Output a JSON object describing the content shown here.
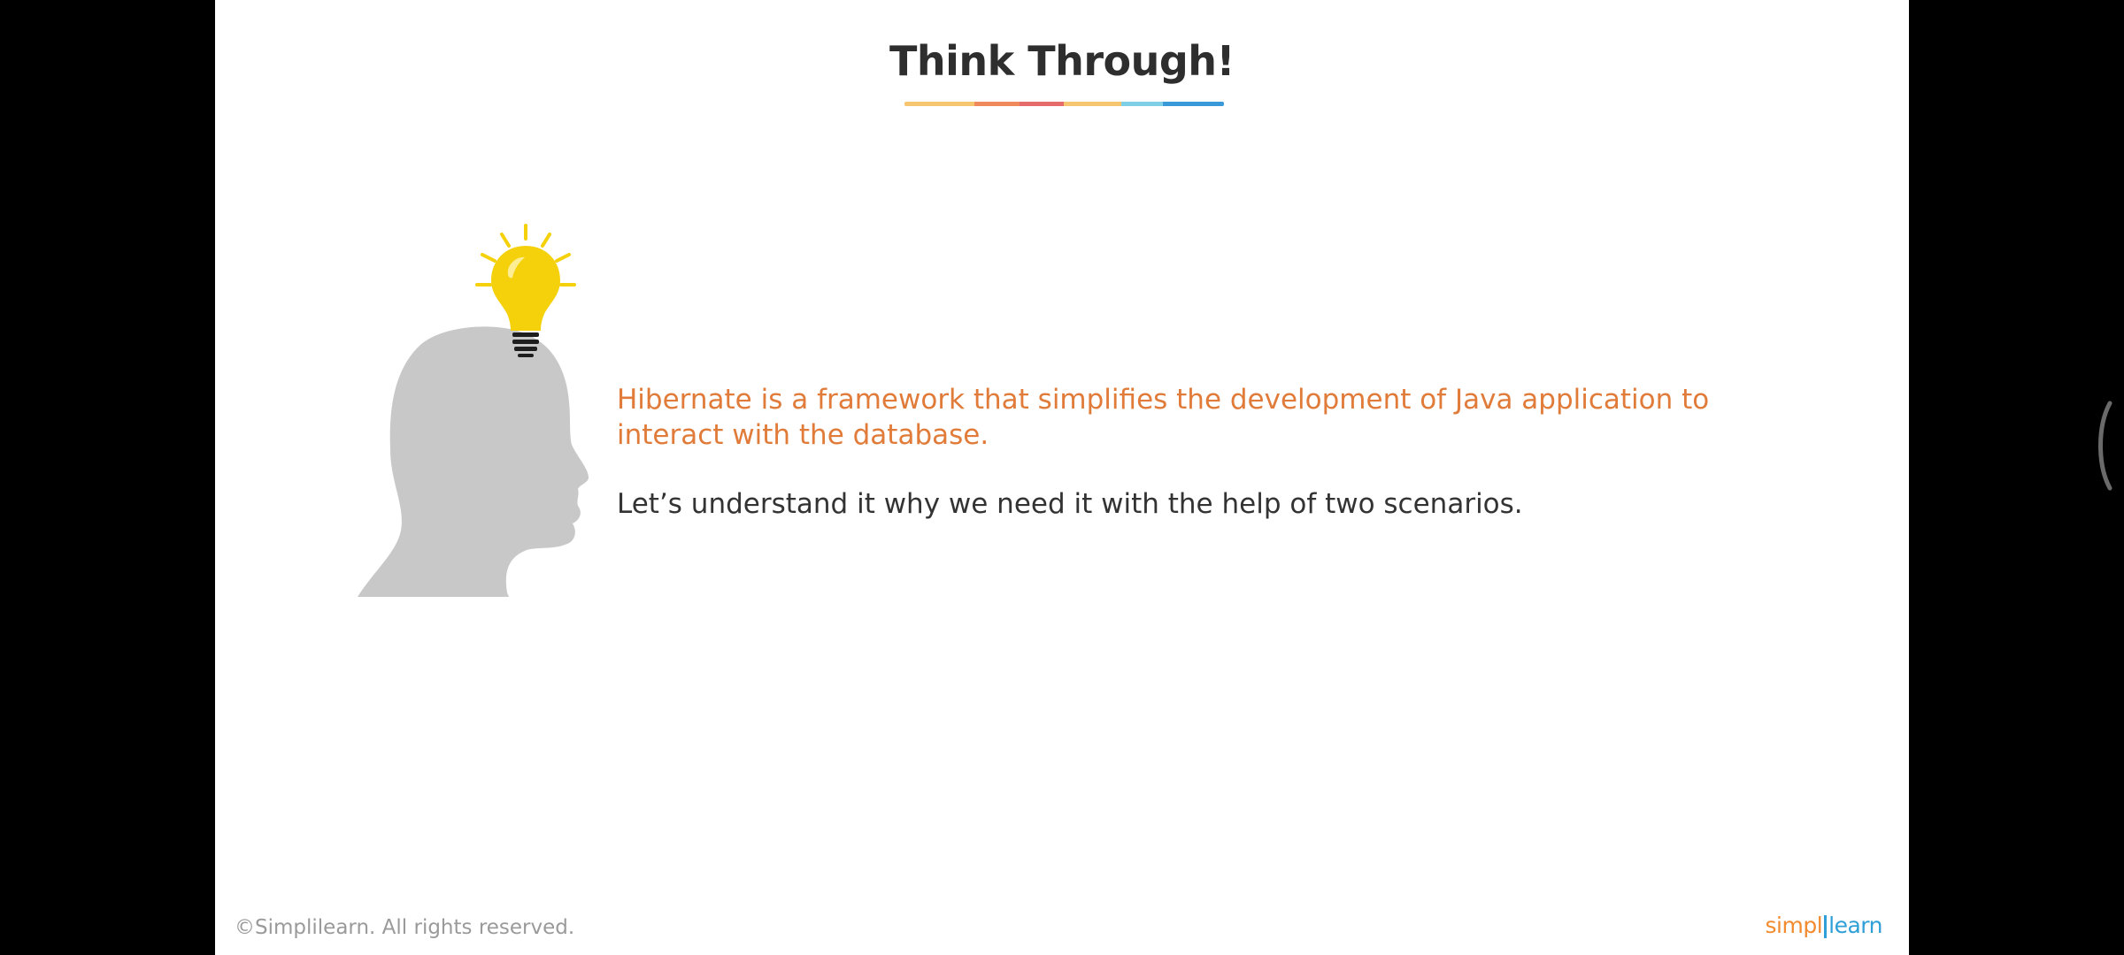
{
  "slide": {
    "title": "Think Through!",
    "underline_colors": [
      "#f6c570",
      "#f08a5d",
      "#e66b6b",
      "#f6c570",
      "#7fd0e6",
      "#3a9ad9"
    ],
    "highlight_text": "Hibernate is a framework that simplifies the development of Java application to interact with the database.",
    "body_text": "Let’s understand it why we need it with the help of two scenarios.",
    "footer": {
      "copyright": "©Simplilearn. All rights reserved.",
      "logo_left": "simpl",
      "logo_right": "learn"
    }
  },
  "icons": {
    "illustration": "head-with-lightbulb-icon",
    "side_handle": "side-panel-handle-icon"
  },
  "colors": {
    "accent_orange": "#e07b39",
    "bulb_yellow": "#f5d10c",
    "head_gray": "#c8c8c8",
    "brand_orange": "#f28b30",
    "brand_blue": "#2f9fd8"
  }
}
